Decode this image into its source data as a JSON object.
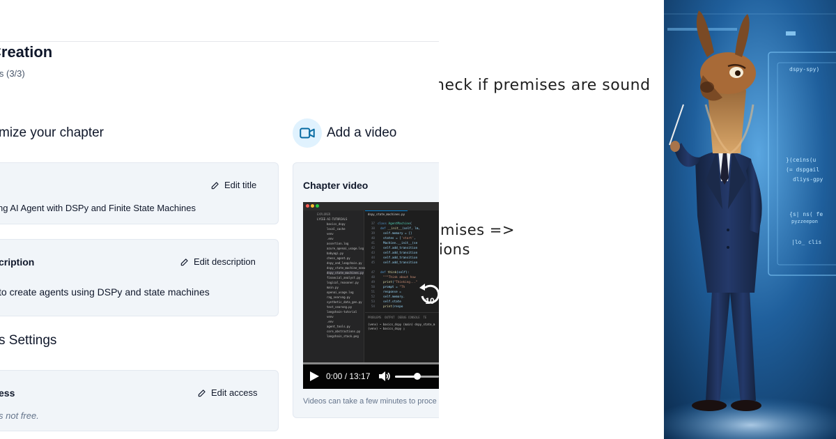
{
  "editor": {
    "title": "Creation",
    "subtitle": "ls (3/3)",
    "customize_section": "mize your chapter",
    "video_section": "Add a video",
    "access_section": "s Settings",
    "title_card": {
      "action": "Edit title",
      "value": "ng AI Agent with DSPy and Finite State Machines"
    },
    "description_card": {
      "label": "cription",
      "action": "Edit description",
      "value": "to create agents using DSPy and state machines"
    },
    "access_card": {
      "label": "ess",
      "action": "Edit access",
      "value": "s not free."
    },
    "video_card": {
      "label": "Chapter video",
      "time": "0:00 / 13:17",
      "replay_seconds": "10",
      "volume_level": 0.5,
      "note": "Videos can take a few minutes to proce"
    }
  },
  "whiteboard": {
    "line1": "heck if premises are sound",
    "line2": "mises =>",
    "line3": "ions"
  },
  "illustration": {
    "code_lines": [
      "dspy-spy)",
      "}(ceins(u",
      "(= dspgail",
      "dliys-gpy",
      "{s| ns( fe",
      "pyzzeepon",
      "|lo_ clis"
    ]
  },
  "colors": {
    "accent": "#0369a1",
    "card_bg": "#f1f5f9",
    "navy": "#1b2a4a"
  }
}
